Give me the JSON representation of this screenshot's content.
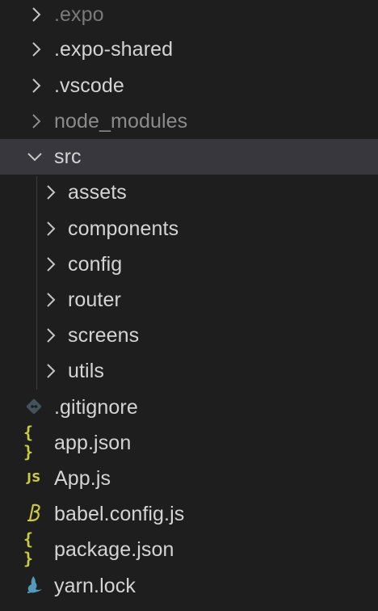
{
  "explorer": {
    "items": [
      {
        "label": ".expo",
        "kind": "folder",
        "state": "collapsed",
        "depth": 0
      },
      {
        "label": ".expo-shared",
        "kind": "folder",
        "state": "collapsed",
        "depth": 0
      },
      {
        "label": ".vscode",
        "kind": "folder",
        "state": "collapsed",
        "depth": 0
      },
      {
        "label": "node_modules",
        "kind": "folder",
        "state": "collapsed",
        "depth": 0
      },
      {
        "label": "src",
        "kind": "folder",
        "state": "expanded",
        "depth": 0,
        "selected": true
      },
      {
        "label": "assets",
        "kind": "folder",
        "state": "collapsed",
        "depth": 1
      },
      {
        "label": "components",
        "kind": "folder",
        "state": "collapsed",
        "depth": 1
      },
      {
        "label": "config",
        "kind": "folder",
        "state": "collapsed",
        "depth": 1
      },
      {
        "label": "router",
        "kind": "folder",
        "state": "collapsed",
        "depth": 1
      },
      {
        "label": "screens",
        "kind": "folder",
        "state": "collapsed",
        "depth": 1
      },
      {
        "label": "utils",
        "kind": "folder",
        "state": "collapsed",
        "depth": 1
      },
      {
        "label": ".gitignore",
        "kind": "file",
        "icon": "git-icon",
        "depth": 0
      },
      {
        "label": "app.json",
        "kind": "file",
        "icon": "json-icon",
        "depth": 0
      },
      {
        "label": "App.js",
        "kind": "file",
        "icon": "javascript-icon",
        "depth": 0
      },
      {
        "label": "babel.config.js",
        "kind": "file",
        "icon": "babel-icon",
        "depth": 0
      },
      {
        "label": "package.json",
        "kind": "file",
        "icon": "json-icon",
        "depth": 0
      },
      {
        "label": "yarn.lock",
        "kind": "file",
        "icon": "yarn-icon",
        "depth": 0
      }
    ],
    "icon_glyphs": {
      "json": "{ }",
      "javascript": "JS"
    }
  },
  "colors": {
    "background": "#1e1e1e",
    "selected_row": "#37373d",
    "text": "#d4d4d4",
    "ignored_text": "#8b8b8b",
    "json_yellow": "#cbcb41",
    "git_gray": "#41535b",
    "babel_yellow": "#cbcb41",
    "yarn_blue": "#519aba"
  }
}
